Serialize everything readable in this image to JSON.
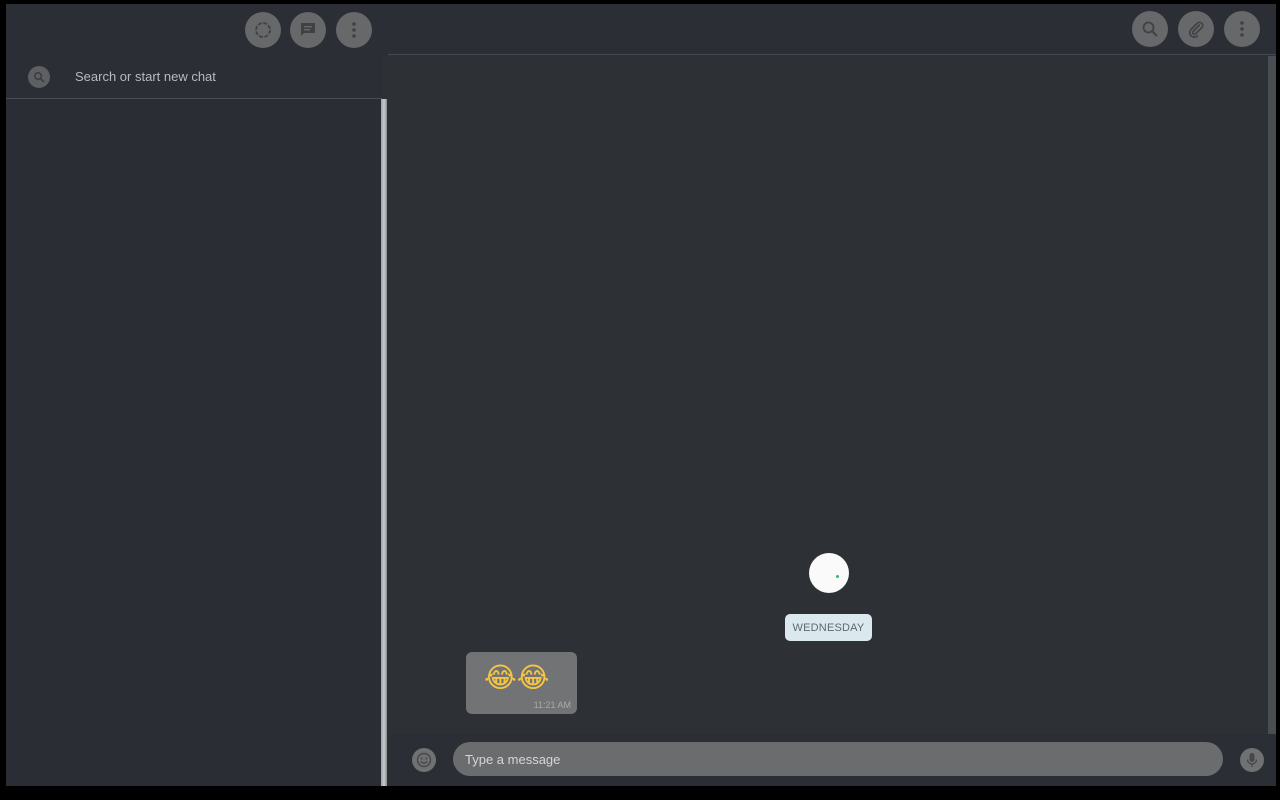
{
  "left_header": {
    "icons": [
      "status-icon",
      "new-chat-icon",
      "menu-icon"
    ]
  },
  "search": {
    "placeholder": "Search or start new chat"
  },
  "chat_header": {
    "icons": [
      "search-icon",
      "attach-icon",
      "menu-icon"
    ]
  },
  "conversation": {
    "date_divider": "WEDNESDAY",
    "messages": [
      {
        "content": "😂😂",
        "time": "11:21 AM",
        "direction": "incoming"
      }
    ]
  },
  "composer": {
    "placeholder": "Type a message",
    "icons": [
      "emoji-icon",
      "mic-icon"
    ]
  },
  "colors": {
    "app_background": "#2d3036",
    "bubble": "#727374",
    "date_pill": "#dbe8ee",
    "input": "#6b6c6d",
    "loader_dot": "#3bb56a"
  }
}
